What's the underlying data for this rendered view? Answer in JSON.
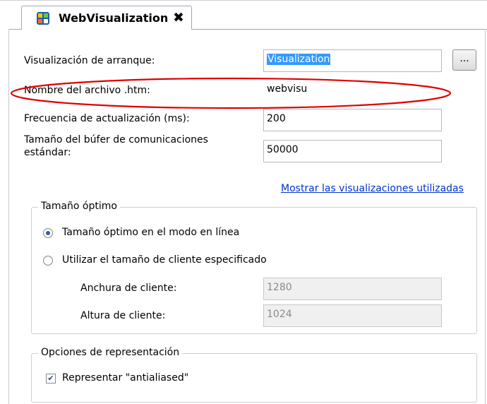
{
  "tab": {
    "title": "WebVisualization",
    "close": "✖",
    "icon": "visualization-icon"
  },
  "fields": {
    "start_visualization": {
      "label": "Visualización de arranque:",
      "value": "Visualization"
    },
    "browse_button": "...",
    "htm_filename": {
      "label": "Nombre del archivo .htm:",
      "value": "webvisu"
    },
    "update_rate": {
      "label": "Frecuencia de actualización (ms):",
      "value": "200"
    },
    "buffer_size": {
      "label_line1": "Tamaño del búfer de comunicaciones",
      "label_line2": "estándar:",
      "value": "50000"
    }
  },
  "link": "Mostrar las visualizaciones utilizadas",
  "optimal_size": {
    "title": "Tamaño óptimo",
    "option_online": "Tamaño óptimo en el modo en línea",
    "option_client": "Utilizar el tamaño de cliente especificado",
    "selected": "option_online",
    "client_width": {
      "label": "Anchura de cliente:",
      "value": "1280"
    },
    "client_height": {
      "label": "Altura de cliente:",
      "value": "1024"
    }
  },
  "render_options": {
    "title": "Opciones de representación",
    "antialiased": {
      "label": "Representar \"antialiased\"",
      "checked": true
    }
  },
  "annotation_color": "#e00000"
}
